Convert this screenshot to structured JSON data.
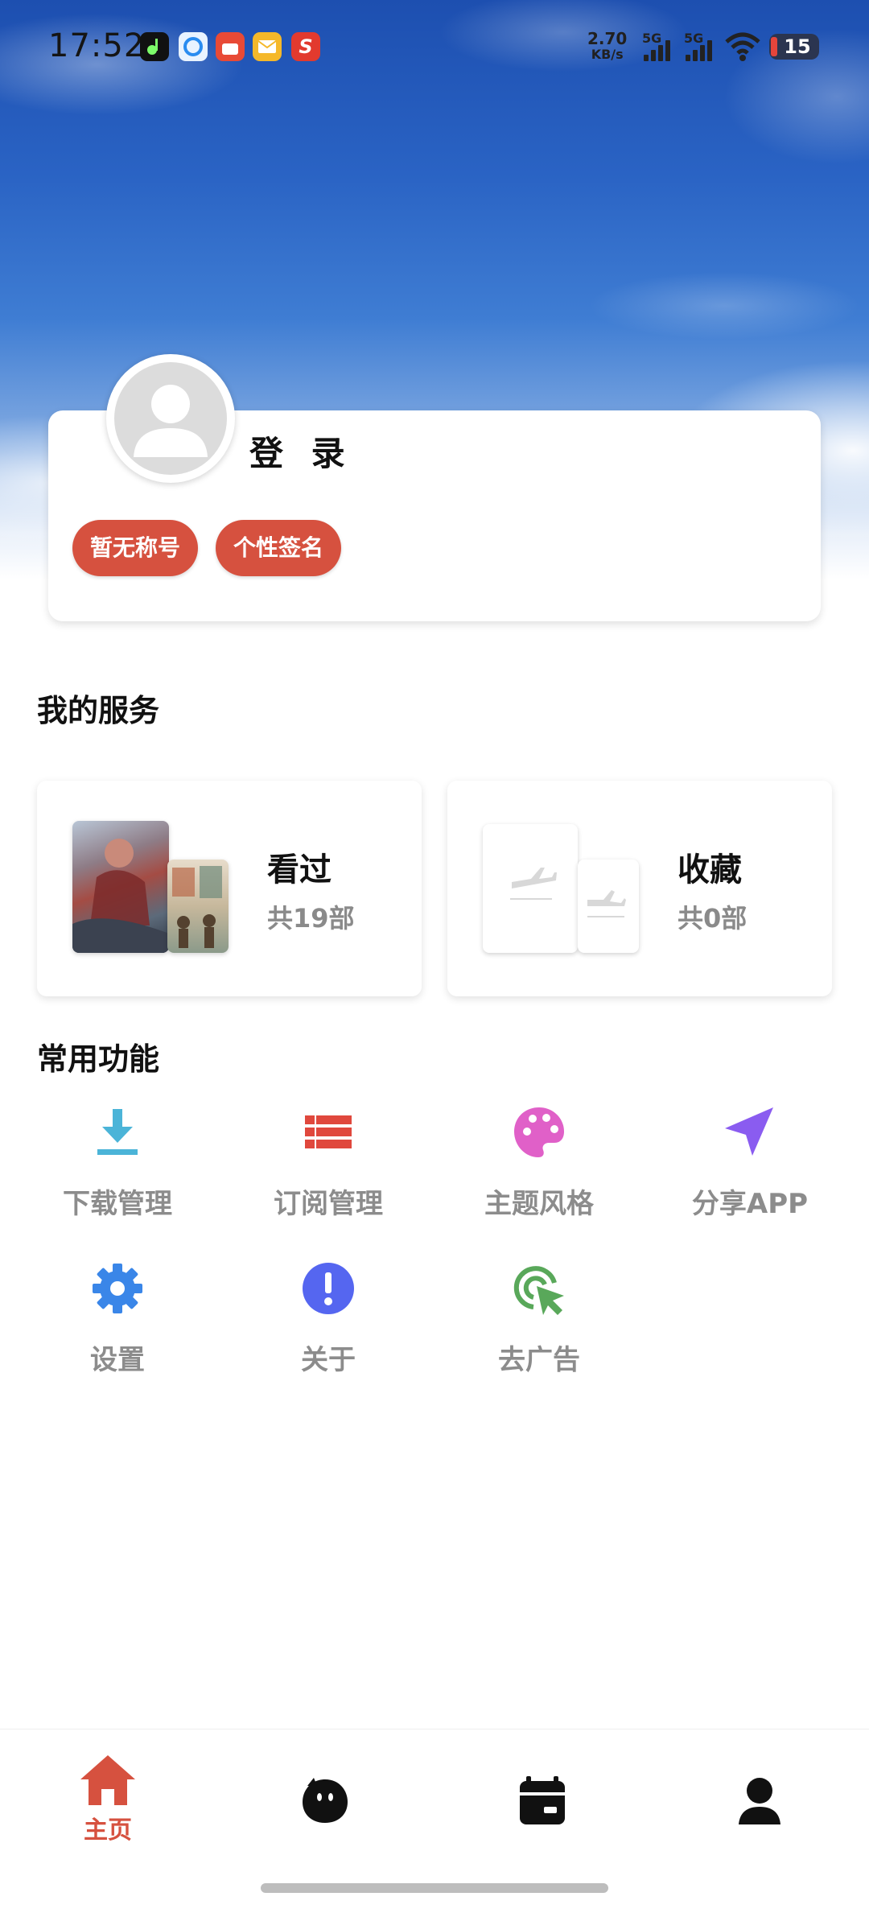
{
  "status_bar": {
    "time": "17:52",
    "net_speed_value": "2.70",
    "net_speed_unit": "KB/s",
    "signal1_label": "5G",
    "signal2_label": "5G",
    "battery": "15"
  },
  "profile": {
    "login_label": "登 录",
    "tags": [
      "暂无称号",
      "个性签名"
    ]
  },
  "services": {
    "title": "我的服务",
    "cards": [
      {
        "title": "看过",
        "count": "共19部"
      },
      {
        "title": "收藏",
        "count": "共0部"
      }
    ]
  },
  "functions": {
    "title": "常用功能",
    "items": [
      {
        "label": "下载管理",
        "icon": "download-icon",
        "color": "#4bb4d8"
      },
      {
        "label": "订阅管理",
        "icon": "list-icon",
        "color": "#e0483d"
      },
      {
        "label": "主题风格",
        "icon": "palette-icon",
        "color": "#e060c8"
      },
      {
        "label": "分享APP",
        "icon": "send-icon",
        "color": "#8a5cf0"
      },
      {
        "label": "设置",
        "icon": "gear-icon",
        "color": "#3a86e8"
      },
      {
        "label": "关于",
        "icon": "info-icon",
        "color": "#5566f0"
      },
      {
        "label": "去广告",
        "icon": "ad-click-icon",
        "color": "#59a85a"
      }
    ]
  },
  "bottom_nav": {
    "items": [
      {
        "label": "主页",
        "icon": "home-icon",
        "active": true
      },
      {
        "label": "",
        "icon": "mascot-icon",
        "active": false
      },
      {
        "label": "",
        "icon": "calendar-icon",
        "active": false
      },
      {
        "label": "",
        "icon": "user-icon",
        "active": false
      }
    ],
    "accent": "#d6513f"
  }
}
